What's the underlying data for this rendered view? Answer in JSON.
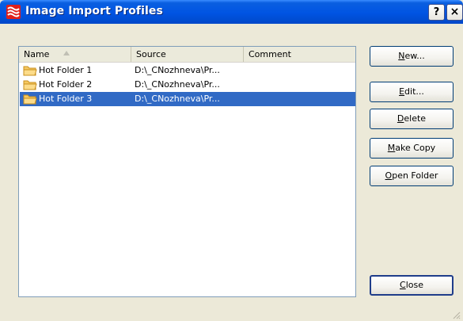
{
  "window": {
    "title": "Image Import Profiles",
    "help_label": "?",
    "close_label": "×"
  },
  "list": {
    "columns": [
      "Name",
      "Source",
      "Comment"
    ],
    "rows": [
      {
        "name": "Hot Folder 1",
        "source": "D:\\_CNozhneva\\Pr...",
        "comment": "",
        "selected": false,
        "icon": "folder-icon"
      },
      {
        "name": "Hot Folder 2",
        "source": "D:\\_CNozhneva\\Pr...",
        "comment": "",
        "selected": false,
        "icon": "folder-icon"
      },
      {
        "name": "Hot Folder 3",
        "source": "D:\\_CNozhneva\\Pr...",
        "comment": "",
        "selected": true,
        "icon": "folder-icon"
      }
    ]
  },
  "buttons": {
    "new": {
      "mnemonic": "N",
      "rest": "ew..."
    },
    "edit": {
      "mnemonic": "E",
      "rest": "dit..."
    },
    "delete": {
      "mnemonic": "D",
      "rest": "elete"
    },
    "make_copy": {
      "mnemonic": "M",
      "rest": "ake Copy"
    },
    "open_folder": {
      "mnemonic": "O",
      "rest": "pen Folder"
    },
    "close": {
      "mnemonic": "C",
      "rest": "lose"
    }
  },
  "colors": {
    "titlebar": "#0054e3",
    "selection": "#316ac5",
    "dialog_bg": "#ece9d8"
  }
}
